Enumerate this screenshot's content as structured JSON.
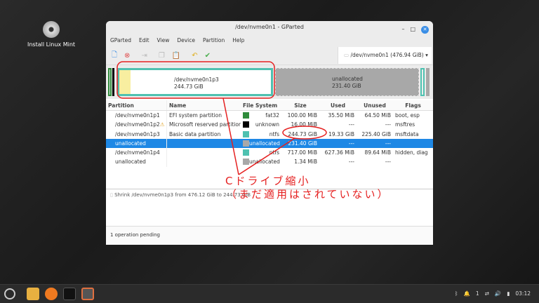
{
  "desktop": {
    "icon_label": "Install Linux Mint"
  },
  "window": {
    "title": "/dev/nvme0n1 - GParted"
  },
  "menu": [
    "GParted",
    "Edit",
    "View",
    "Device",
    "Partition",
    "Help"
  ],
  "device_selector": "/dev/nvme0n1 (476.94 GiB)",
  "graph": {
    "p3_name": "/dev/nvme0n1p3",
    "p3_size": "244.73 GiB",
    "unalloc_name": "unallocated",
    "unalloc_size": "231.40 GiB"
  },
  "table": {
    "headers": [
      "Partition",
      "Name",
      "File System",
      "Size",
      "Used",
      "Unused",
      "Flags"
    ],
    "rows": [
      {
        "partition": "/dev/nvme0n1p1",
        "name": "EFI system partition",
        "fs": "fat32",
        "color": "#2e8b3a",
        "size": "100.00 MiB",
        "used": "35.50 MiB",
        "unused": "64.50 MiB",
        "flags": "boot, esp"
      },
      {
        "partition": "/dev/nvme0n1p2",
        "warn": true,
        "name": "Microsoft reserved partition",
        "fs": "unknown",
        "color": "#000000",
        "size": "16.00 MiB",
        "used": "---",
        "unused": "---",
        "flags": "msftres"
      },
      {
        "partition": "/dev/nvme0n1p3",
        "name": "Basic data partition",
        "fs": "ntfs",
        "color": "#4fc1b0",
        "size": "244.73 GiB",
        "used": "19.33 GiB",
        "unused": "225.40 GiB",
        "flags": "msftdata"
      },
      {
        "partition": "unallocated",
        "name": "",
        "fs": "unallocated",
        "color": "#a8a8a8",
        "size": "231.40 GiB",
        "used": "---",
        "unused": "---",
        "flags": "",
        "selected": true
      },
      {
        "partition": "/dev/nvme0n1p4",
        "name": "",
        "fs": "ntfs",
        "color": "#4fc1b0",
        "size": "717.00 MiB",
        "used": "627.36 MiB",
        "unused": "89.64 MiB",
        "flags": "hidden, diag"
      },
      {
        "partition": "unallocated",
        "name": "",
        "fs": "unallocated",
        "color": "#a8a8a8",
        "size": "1.34 MiB",
        "used": "---",
        "unused": "---",
        "flags": ""
      }
    ]
  },
  "operations": [
    "Shrink /dev/nvme0n1p3 from 476.12 GiB to 244.73 GiB"
  ],
  "status": "1 operation pending",
  "annotation": {
    "line1": "Cドライブ縮小",
    "line2": "（まだ適用はされていない）",
    "color": "#e52020"
  },
  "tray": {
    "notifications": "1",
    "clock": "03:12"
  }
}
